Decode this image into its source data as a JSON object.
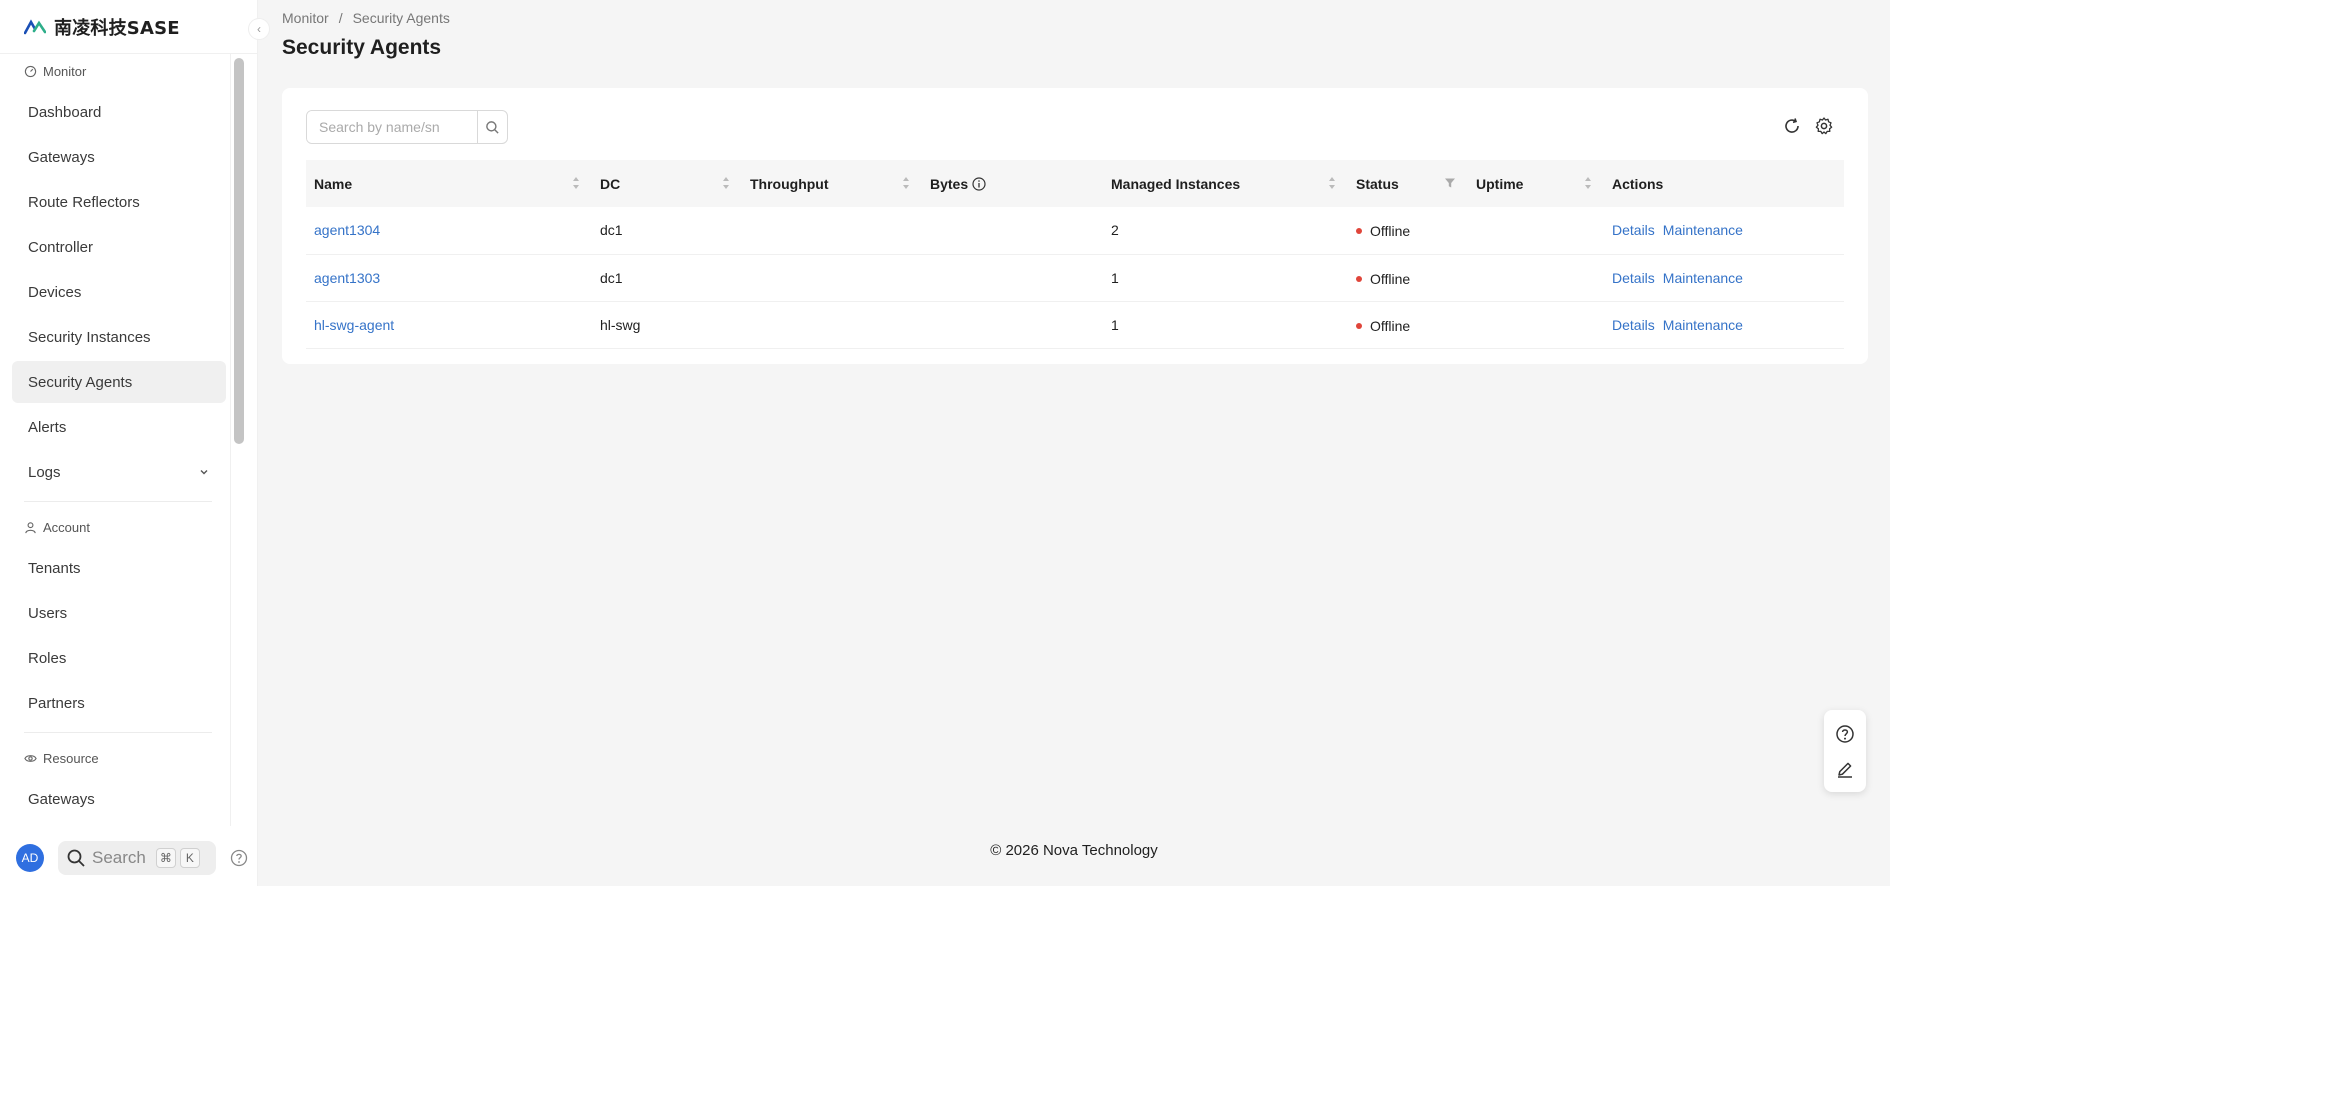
{
  "brand": {
    "name": "南凌科技SASE"
  },
  "sidebar": {
    "groups": [
      {
        "title": "Monitor",
        "icon": "dashboard-gauge-icon",
        "items": [
          {
            "label": "Dashboard"
          },
          {
            "label": "Gateways"
          },
          {
            "label": "Route Reflectors"
          },
          {
            "label": "Controller"
          },
          {
            "label": "Devices"
          },
          {
            "label": "Security Instances"
          },
          {
            "label": "Security Agents",
            "active": true
          },
          {
            "label": "Alerts"
          },
          {
            "label": "Logs",
            "expandable": true
          }
        ]
      },
      {
        "title": "Account",
        "icon": "user-icon",
        "items": [
          {
            "label": "Tenants"
          },
          {
            "label": "Users"
          },
          {
            "label": "Roles"
          },
          {
            "label": "Partners"
          }
        ]
      },
      {
        "title": "Resource",
        "icon": "resource-eye-icon",
        "items": [
          {
            "label": "Gateways"
          }
        ]
      }
    ],
    "footer": {
      "avatar": "AD",
      "search_label": "Search",
      "kbd_1": "⌘",
      "kbd_2": "K"
    }
  },
  "breadcrumb": {
    "parent": "Monitor",
    "separator": "/",
    "current": "Security Agents"
  },
  "page": {
    "title": "Security Agents"
  },
  "search": {
    "placeholder": "Search by name/sn"
  },
  "table": {
    "columns": [
      "Name",
      "DC",
      "Throughput",
      "Bytes",
      "Managed Instances",
      "Status",
      "Uptime",
      "Actions"
    ],
    "rows": [
      {
        "name": "agent1304",
        "dc": "dc1",
        "throughput": "",
        "bytes": "",
        "managed_instances": "2",
        "status": "Offline",
        "uptime": "",
        "action_details": "Details",
        "action_maintenance": "Maintenance"
      },
      {
        "name": "agent1303",
        "dc": "dc1",
        "throughput": "",
        "bytes": "",
        "managed_instances": "1",
        "status": "Offline",
        "uptime": "",
        "action_details": "Details",
        "action_maintenance": "Maintenance"
      },
      {
        "name": "hl-swg-agent",
        "dc": "hl-swg",
        "throughput": "",
        "bytes": "",
        "managed_instances": "1",
        "status": "Offline",
        "uptime": "",
        "action_details": "Details",
        "action_maintenance": "Maintenance"
      }
    ]
  },
  "footer": {
    "copyright": "© 2026 Nova Technology"
  },
  "colors": {
    "link": "#3573c8",
    "offline": "#e0453a",
    "avatar": "#2f6fe0"
  }
}
